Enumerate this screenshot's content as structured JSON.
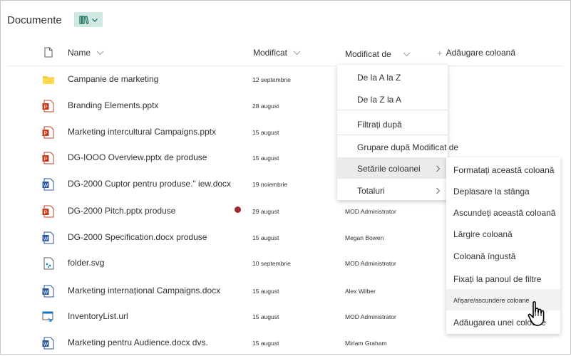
{
  "page": {
    "title": "Documente"
  },
  "toolbar": {
    "view_icon": "library-view-icon",
    "view_chevron": "chevron-down-icon"
  },
  "header": {
    "name": "Name",
    "modified": "Modificat",
    "modified_by": "Modificat de",
    "add_column": "Adăugare coloană"
  },
  "rows": [
    {
      "type": "folder",
      "icon": "folder-icon",
      "name": "Campanie de marketing",
      "modified": "12 septembrie",
      "modified_by": ""
    },
    {
      "type": "pptx",
      "icon": "powerpoint-icon",
      "name": "Branding Elements.pptx",
      "modified": "28 august",
      "modified_by": ""
    },
    {
      "type": "pptx",
      "icon": "powerpoint-icon",
      "name": "Marketing intercultural Campaigns.pptx",
      "modified": "15 august",
      "modified_by": ""
    },
    {
      "type": "pptx",
      "icon": "powerpoint-icon",
      "name": "DG-IOOO Overview.pptx de produse",
      "modified": "15 august",
      "modified_by": ""
    },
    {
      "type": "docx",
      "icon": "word-icon",
      "name": "DG-2000 Cuptor pentru produse.\" iew.docx",
      "modified": "19 noiembrie",
      "modified_by": ""
    },
    {
      "type": "pptx",
      "icon": "powerpoint-icon",
      "name": "DG-2000 Pitch.pptx produse",
      "modified": "29 august",
      "modified_by": "MOD Administrator"
    },
    {
      "type": "docx",
      "icon": "word-icon",
      "name": "DG-2000 Specification.docx produse",
      "modified": "15 august",
      "modified_by": "Megan Bowen"
    },
    {
      "type": "svg",
      "icon": "image-file-icon",
      "name": "folder.svg",
      "modified": "10 septembrie",
      "modified_by": "MOD Administrator"
    },
    {
      "type": "docx",
      "icon": "word-icon",
      "name": "Marketing internațional Campaigns.docx",
      "modified": "15 august",
      "modified_by": "Alex Wilber"
    },
    {
      "type": "url",
      "icon": "link-file-icon",
      "name": "InventoryList.url",
      "modified": "15 august",
      "modified_by": "MOD Administrator"
    },
    {
      "type": "docx",
      "icon": "word-icon",
      "name": "Marketing pentru Audience.docx dvs.",
      "modified": "15 august",
      "modified_by": "Miriam Graham"
    }
  ],
  "column_menu": {
    "items": [
      {
        "label": "De la A la Z"
      },
      {
        "label": "De la Z la A"
      },
      {
        "label": "Filtrați după"
      },
      {
        "label": "Grupare după Modificat de"
      },
      {
        "label": "Setările coloanei"
      },
      {
        "label": "Totaluri"
      }
    ]
  },
  "settings_menu": {
    "items": [
      {
        "label": "Formatați această coloană"
      },
      {
        "label": "Deplasare la stânga"
      },
      {
        "label": "Ascundeți această coloană"
      },
      {
        "label": "Lărgire coloană"
      },
      {
        "label": "Coloană îngustă"
      },
      {
        "label": "Fixați la panoul de filtre"
      },
      {
        "label": "Afișare/ascundere coloane"
      },
      {
        "label": "Adăugarea unei coloane"
      }
    ]
  },
  "colors": {
    "accent": "#cfe8e2",
    "folder": "#f2c94c",
    "powerpoint": "#c43e1c",
    "word": "#2b579a",
    "alert": "#a4262c"
  }
}
